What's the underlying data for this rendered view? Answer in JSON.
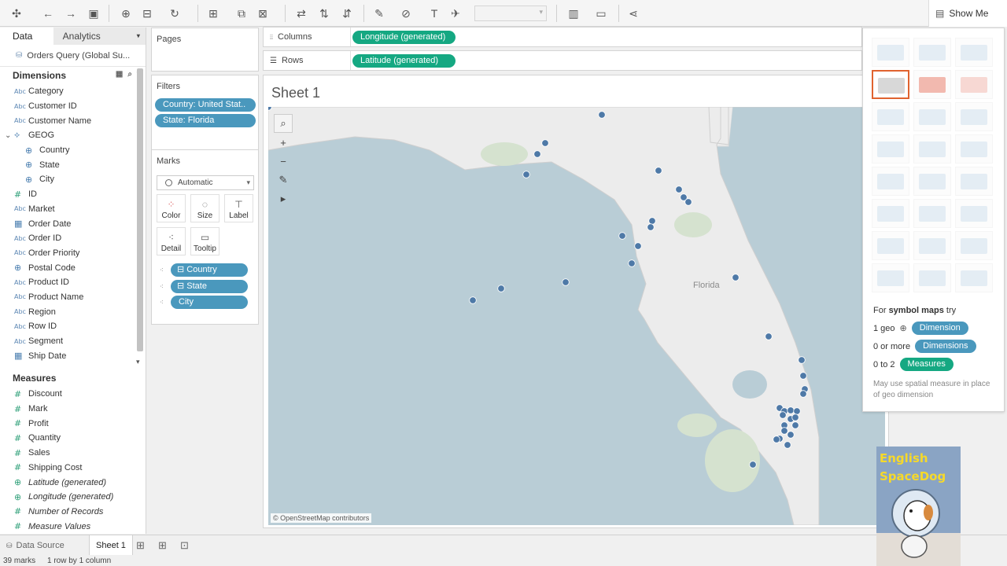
{
  "toolbar": {
    "icons": [
      "tableau-logo-icon",
      "undo-icon",
      "redo-icon",
      "save-icon",
      "new-datasource-icon",
      "pause-updates-icon",
      "refresh-icon",
      "new-worksheet-icon",
      "duplicate-icon",
      "clear-icon",
      "swap-icon",
      "sort-asc-icon",
      "sort-desc-icon",
      "highlight-icon",
      "group-icon",
      "labels-icon",
      "fix-axes-icon",
      "fit-icon",
      "presentation-icon",
      "share-icon"
    ],
    "show_me_label": "Show Me"
  },
  "data_pane": {
    "tab_data": "Data",
    "tab_analytics": "Analytics",
    "datasource": "Orders Query (Global Su...",
    "dimensions_title": "Dimensions",
    "dimensions": [
      {
        "type": "Abc",
        "label": "Category"
      },
      {
        "type": "Abc",
        "label": "Customer ID"
      },
      {
        "type": "Abc",
        "label": "Customer Name"
      },
      {
        "type": "geo-hier",
        "label": "GEOG"
      },
      {
        "type": "geo",
        "label": "Country"
      },
      {
        "type": "geo",
        "label": "State"
      },
      {
        "type": "geo-link",
        "label": "City"
      },
      {
        "type": "#",
        "label": "ID"
      },
      {
        "type": "Abc",
        "label": "Market"
      },
      {
        "type": "date",
        "label": "Order Date"
      },
      {
        "type": "Abc",
        "label": "Order ID"
      },
      {
        "type": "Abc",
        "label": "Order Priority"
      },
      {
        "type": "geo",
        "label": "Postal Code"
      },
      {
        "type": "Abc",
        "label": "Product ID"
      },
      {
        "type": "Abc",
        "label": "Product Name"
      },
      {
        "type": "Abc",
        "label": "Region"
      },
      {
        "type": "Abc",
        "label": "Row ID"
      },
      {
        "type": "Abc",
        "label": "Segment"
      },
      {
        "type": "date",
        "label": "Ship Date"
      }
    ],
    "measures_title": "Measures",
    "measures": [
      {
        "type": "#",
        "label": "Discount"
      },
      {
        "type": "#",
        "label": "Mark"
      },
      {
        "type": "#",
        "label": "Profit"
      },
      {
        "type": "#",
        "label": "Quantity"
      },
      {
        "type": "#",
        "label": "Sales"
      },
      {
        "type": "#",
        "label": "Shipping Cost"
      },
      {
        "type": "geo",
        "label": "Latitude (generated)"
      },
      {
        "type": "geo",
        "label": "Longitude (generated)"
      },
      {
        "type": "#",
        "label": "Number of Records"
      },
      {
        "type": "#",
        "label": "Measure Values"
      }
    ]
  },
  "cards": {
    "pages_title": "Pages",
    "filters_title": "Filters",
    "filters": [
      "Country: United Stat..",
      "State: Florida"
    ],
    "marks_title": "Marks",
    "marks_type": "Automatic",
    "marks_buttons": [
      "Color",
      "Size",
      "Label",
      "Detail",
      "Tooltip"
    ],
    "marks_fields": [
      "Country",
      "State",
      "City"
    ]
  },
  "shelves": {
    "columns_label": "Columns",
    "columns_pill": "Longitude (generated)",
    "rows_label": "Rows",
    "rows_pill": "Latitude (generated)"
  },
  "view": {
    "sheet_title": "Sheet 1",
    "map_label": "Florida",
    "attribution": "© OpenStreetMap contributors",
    "mark_color": "#4e79a7"
  },
  "show_me": {
    "hint_prefix": "For ",
    "hint_bold": "symbol maps",
    "hint_suffix": " try",
    "req1_count": "1 geo",
    "req1_pill": "Dimension",
    "req2_count": "0 or more",
    "req2_pill": "Dimensions",
    "req3_count": "0 to 2",
    "req3_pill": "Measures",
    "note": "May use spatial measure in place of geo dimension"
  },
  "bottom": {
    "data_source_tab": "Data Source",
    "sheet_tab": "Sheet 1",
    "status_marks": "39 marks",
    "status_layout": "1 row by 1 column"
  },
  "watermark": {
    "line1": "English",
    "line2": "SpaceDog"
  }
}
